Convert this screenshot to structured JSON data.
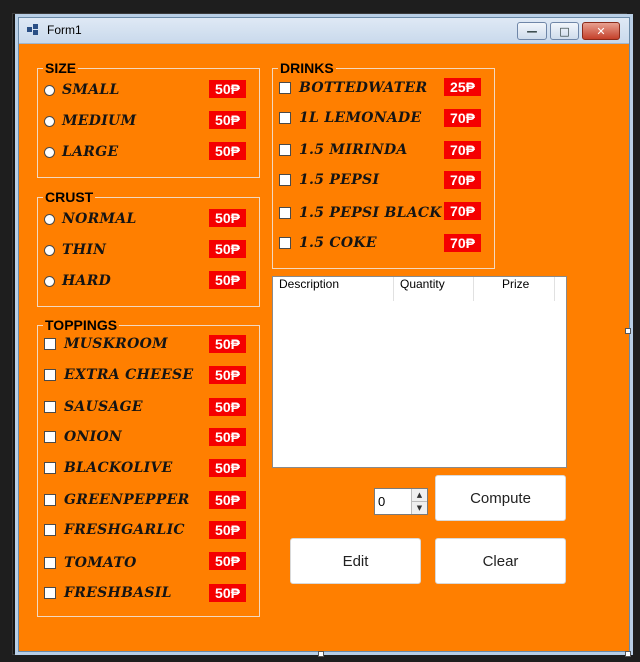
{
  "window": {
    "title": "Form1",
    "minimize_glyph": "—",
    "maximize_glyph": "□",
    "close_glyph": "✕",
    "icon": "form-icon"
  },
  "size": {
    "title": "SIZE",
    "items": [
      {
        "label": "SMALL",
        "price": "50₱"
      },
      {
        "label": "MEDIUM",
        "price": "50₱"
      },
      {
        "label": "LARGE",
        "price": "50₱"
      }
    ]
  },
  "crust": {
    "title": "CRUST",
    "items": [
      {
        "label": "NORMAL",
        "price": "50₱"
      },
      {
        "label": "THIN",
        "price": "50₱"
      },
      {
        "label": "HARD",
        "price": "50₱"
      }
    ]
  },
  "toppings": {
    "title": "TOPPINGS",
    "items": [
      {
        "label": "MUSKROOM",
        "price": "50₱"
      },
      {
        "label": "EXTRA CHEESE",
        "price": "50₱"
      },
      {
        "label": "SAUSAGE",
        "price": "50₱"
      },
      {
        "label": "ONION",
        "price": "50₱"
      },
      {
        "label": "BLACKOLIVE",
        "price": "50₱"
      },
      {
        "label": "GREENPEPPER",
        "price": "50₱"
      },
      {
        "label": "FRESHGARLIC",
        "price": "50₱"
      },
      {
        "label": "TOMATO",
        "price": "50₱"
      },
      {
        "label": "FRESHBASIL",
        "price": "50₱"
      }
    ]
  },
  "drinks": {
    "title": "DRINKS",
    "items": [
      {
        "label": "BOTTEDWATER",
        "price": "25₱"
      },
      {
        "label": "1L LEMONADE",
        "price": "70₱"
      },
      {
        "label": "1.5 MIRINDA",
        "price": "70₱"
      },
      {
        "label": "1.5 PEPSI",
        "price": "70₱"
      },
      {
        "label": "1.5 PEPSI BLACK",
        "price": "70₱"
      },
      {
        "label": "1.5 COKE",
        "price": "70₱"
      }
    ]
  },
  "order_list": {
    "columns": [
      "Description",
      "Quantity",
      "Prize"
    ]
  },
  "quantity": {
    "value": "0",
    "up_glyph": "▲",
    "down_glyph": "▼"
  },
  "buttons": {
    "compute": "Compute",
    "edit": "Edit",
    "clear": "Clear"
  },
  "colors": {
    "form_bg": "#ff7f00",
    "price_bg": "#f50000",
    "price_text": "#ffffff"
  }
}
